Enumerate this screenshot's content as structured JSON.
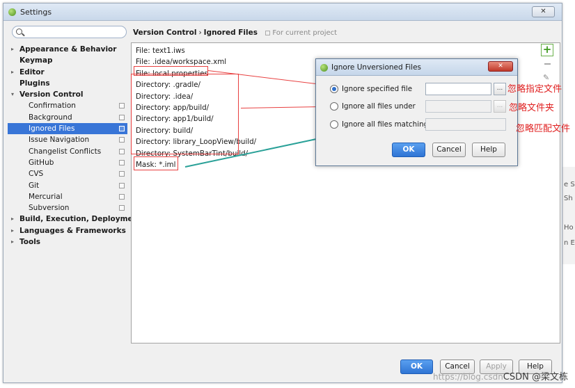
{
  "window": {
    "title": "Settings",
    "close_glyph": "✕"
  },
  "search": {
    "placeholder": ""
  },
  "tree": [
    {
      "label": "Appearance & Behavior",
      "level": 0,
      "arrow": "▸"
    },
    {
      "label": "Keymap",
      "level": 0,
      "arrow": ""
    },
    {
      "label": "Editor",
      "level": 0,
      "arrow": "▸"
    },
    {
      "label": "Plugins",
      "level": 0,
      "arrow": ""
    },
    {
      "label": "Version Control",
      "level": 0,
      "arrow": "▾"
    },
    {
      "label": "Confirmation",
      "level": 1,
      "arrow": "",
      "project_icon": true
    },
    {
      "label": "Background",
      "level": 1,
      "arrow": "",
      "project_icon": true
    },
    {
      "label": "Ignored Files",
      "level": 1,
      "arrow": "",
      "project_icon": true,
      "selected": true
    },
    {
      "label": "Issue Navigation",
      "level": 1,
      "arrow": "",
      "project_icon": true
    },
    {
      "label": "Changelist Conflicts",
      "level": 1,
      "arrow": "",
      "project_icon": true
    },
    {
      "label": "GitHub",
      "level": 1,
      "arrow": "",
      "project_icon": true
    },
    {
      "label": "CVS",
      "level": 1,
      "arrow": "",
      "project_icon": true
    },
    {
      "label": "Git",
      "level": 1,
      "arrow": "",
      "project_icon": true
    },
    {
      "label": "Mercurial",
      "level": 1,
      "arrow": "",
      "project_icon": true
    },
    {
      "label": "Subversion",
      "level": 1,
      "arrow": "",
      "project_icon": true
    },
    {
      "label": "Build, Execution, Deployment",
      "level": 0,
      "arrow": "▸"
    },
    {
      "label": "Languages & Frameworks",
      "level": 0,
      "arrow": "▸"
    },
    {
      "label": "Tools",
      "level": 0,
      "arrow": "▸"
    }
  ],
  "breadcrumb": {
    "parent": "Version Control",
    "separator": "›",
    "current": "Ignored Files",
    "scope": "For current project"
  },
  "ignored_list": [
    "File: text1.iws",
    "File: .idea/workspace.xml",
    "File: local.properties",
    "Directory: .gradle/",
    "Directory: .idea/",
    "Directory: app/build/",
    "Directory: app1/build/",
    "Directory: build/",
    "Directory: library_LoopView/build/",
    "Directory: SystemBarTint/build/",
    "Mask: *.iml"
  ],
  "toolbar": {
    "add_glyph": "+",
    "edit_glyph": "✎"
  },
  "buttons": {
    "ok": "OK",
    "cancel": "Cancel",
    "apply": "Apply",
    "help": "Help"
  },
  "dialog": {
    "title": "Ignore Unversioned Files",
    "close_glyph": "✕",
    "options": [
      {
        "label": "Ignore specified file",
        "checked": true
      },
      {
        "label": "Ignore all files under",
        "checked": false
      },
      {
        "label": "Ignore all files matching",
        "checked": false
      }
    ],
    "browse_glyph": "...",
    "ok": "OK",
    "cancel": "Cancel",
    "help": "Help"
  },
  "annotations": [
    "忽略指定文件",
    "忽略文件夹",
    "忽略匹配文件"
  ],
  "watermark": {
    "url": "https://blog.csdn",
    "brand": "CSDN @梁文栋"
  },
  "background_fragments": [
    "e S",
    "Sh",
    "Ho",
    "n E"
  ],
  "colors": {
    "accent": "#3875d7",
    "annotation_red": "#e84040",
    "annotation_teal": "#2aa198",
    "ok_button": "#2f74d4"
  }
}
